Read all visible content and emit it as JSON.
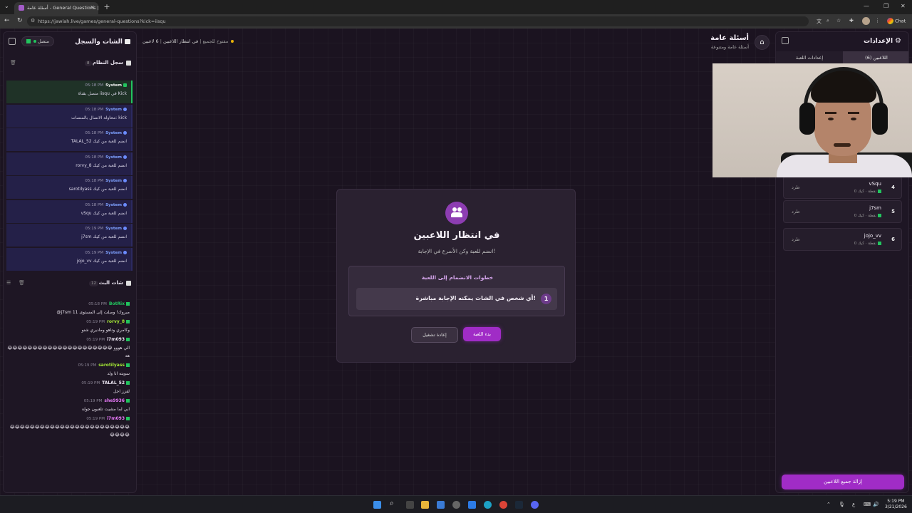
{
  "browser": {
    "tab_title": "أسئلة عامة - General Questions | ...",
    "url": "https://jawlah.live/games/general-questions?kick=iisqu",
    "chat_button": "Chat"
  },
  "left_panel": {
    "title": "الشات والسجل",
    "status": "متصل",
    "system_log": {
      "title": "سجل النظام",
      "count": "8",
      "entries": [
        {
          "time": "05:18 PM",
          "source": "System",
          "text": "متصل بقناة iisqu في Kick"
        },
        {
          "time": "05:18 PM",
          "source": "System",
          "text": "محاولة الاتصال بالمنصات: kick"
        },
        {
          "time": "05:18 PM",
          "source": "System",
          "text": "TALAL_52 انضم للعبة من كيك"
        },
        {
          "time": "05:18 PM",
          "source": "System",
          "text": "rorvy_8 انضم للعبة من كيك"
        },
        {
          "time": "05:18 PM",
          "source": "System",
          "text": "sarotilyass انضم للعبة من كيك"
        },
        {
          "time": "05:18 PM",
          "source": "System",
          "text": "vSqu انضم للعبة من كيك"
        },
        {
          "time": "05:19 PM",
          "source": "System",
          "text": "j7sm انضم للعبة من كيك"
        },
        {
          "time": "05:19 PM",
          "source": "System",
          "text": "jojo_vv انضم للعبة من كيك"
        }
      ]
    },
    "stream_chat": {
      "title": "شات البث",
      "count": "12",
      "messages": [
        {
          "time": "05:18 PM",
          "user": "BotRix",
          "color": "#22c55e",
          "text": "@j7sm مبروك! وصلت إلى المستوى 11"
        },
        {
          "time": "05:19 PM",
          "user": "rorvy_8",
          "color": "#a3e635",
          "text": "وكامري وتاهو وماديري شنو"
        },
        {
          "time": "05:19 PM",
          "user": "i7m093",
          "color": "#e8e2ee",
          "text": "الي هووو 😂😂😂😂😂😂😂😂😂😂😂😂😂😂😂😂😂😂😂😂😂 هه"
        },
        {
          "time": "05:19 PM",
          "user": "sarotilyass",
          "color": "#a3e635",
          "text": "سويته انا ولد"
        },
        {
          "time": "05:19 PM",
          "user": "TALAL_52",
          "color": "#e8e2ee",
          "text": "لقزز اجل"
        },
        {
          "time": "05:19 PM",
          "user": "she9936",
          "color": "#e879f9",
          "text": "ابي لما مشيت تلعبون جولة"
        },
        {
          "time": "05:19 PM",
          "user": "i7m093",
          "color": "#e879f9",
          "text": "😂😂😂😂😂😂😂😂😂😂😂😂😂😂😂😂😂😂😂😂😂😂😂😂😂😂😂😂"
        }
      ]
    }
  },
  "center": {
    "players_count": "6 لاعبين",
    "status": "في انتظار اللاعبين",
    "open_label": "مفتوح للجميع",
    "game_title": "أسئلة عامة",
    "game_subtitle": "أسئلة عامة ومتنوعة",
    "card": {
      "title": "في انتظار اللاعبين",
      "subtitle": "انضم للعبة وكن الأسرع في الإجابة!",
      "steps_title": "خطوات الانضمام إلى اللعبة",
      "step1_num": "1",
      "step1_text": "أي شخص في الشات يمكنه الإجابة مباشرة!",
      "start_button": "بدء اللعبة",
      "restart_button": "إعادة تشغيل"
    }
  },
  "right_panel": {
    "title": "الإعدادات",
    "tab_players": "اللاعبين (6)",
    "tab_settings": "إعدادات اللعبة",
    "players": [
      {
        "num": "4",
        "name": "vSqu",
        "platform": "كيك",
        "points": "0 نقطة",
        "kick": "طرد"
      },
      {
        "num": "5",
        "name": "j7sm",
        "platform": "كيك",
        "points": "0 نقطة",
        "kick": "طرد"
      },
      {
        "num": "6",
        "name": "jojo_vv",
        "platform": "كيك",
        "points": "0 نقطة",
        "kick": "طرد"
      }
    ],
    "remove_all": "إزالة جميع اللاعبين"
  },
  "taskbar": {
    "time": "5:19 PM",
    "date": "3/21/2026",
    "lang": "ع"
  },
  "colors": {
    "accent": "#a02cc6",
    "kick_green": "#22c55e"
  }
}
